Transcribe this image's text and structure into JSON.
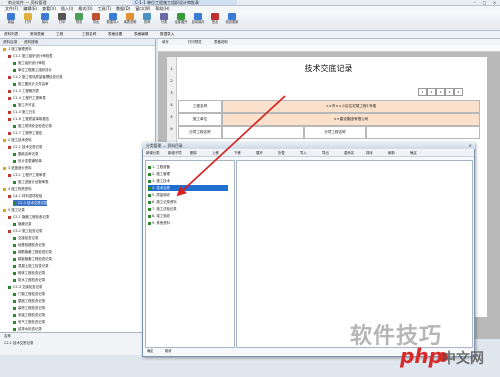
{
  "window": {
    "app_title": "筑业软件 — 资料管理",
    "document_title": "C-1-1 单位工程施工组织设计审批表",
    "controls": [
      "–",
      "□",
      "×"
    ]
  },
  "menubar": [
    "文件(F)",
    "编辑(E)",
    "查看(V)",
    "插入(I)",
    "格式(O)",
    "工具(T)",
    "数据(D)",
    "窗口(W)",
    "帮助(H)"
  ],
  "toolbar": [
    {
      "label": "新建",
      "color": "#3a7bd5"
    },
    {
      "label": "打开",
      "color": "#e0b040"
    },
    {
      "label": "保存",
      "color": "#3a7bd5"
    },
    {
      "label": "打印",
      "color": "#555555"
    },
    {
      "label": "预览",
      "color": "#4aa05a"
    },
    {
      "label": "导出",
      "color": "#c05030"
    },
    {
      "label": "数据导入",
      "color": "#3a7bd5"
    },
    {
      "label": "填表说明",
      "color": "#e09030"
    },
    {
      "label": "查询",
      "color": "#4a90c0"
    },
    {
      "label": "分类",
      "color": "#6a6aa0"
    },
    {
      "label": "全部展开",
      "color": "#3a9a3a"
    },
    {
      "label": "自动保存",
      "color": "#3a7bd5"
    },
    {
      "label": "签名",
      "color": "#c03030"
    },
    {
      "label": "检查更新",
      "color": "#3a7bd5"
    }
  ],
  "tabs": [
    "资料列表",
    "常用表格",
    "工程",
    "工程名称",
    "表格设置",
    "表格编辑",
    "数据录入"
  ],
  "left_panel": {
    "header": [
      "资料目录",
      "资料搜索"
    ],
    "tree": [
      {
        "text": "1 施工管理资料",
        "level": 0,
        "color": "o"
      },
      {
        "text": "C1-1 施工组织设计审批表",
        "level": 1,
        "color": "r"
      },
      {
        "text": "施工组织设计审批",
        "level": 2,
        "color": "g"
      },
      {
        "text": "单位工程施工组织设计",
        "level": 2,
        "color": "g"
      },
      {
        "text": "C1-2 施工现场质量管理检查记录",
        "level": 1,
        "color": "r"
      },
      {
        "text": "施工图设计文件会审",
        "level": 2,
        "color": "g"
      },
      {
        "text": "C1-3 工程概况表",
        "level": 1,
        "color": "r"
      },
      {
        "text": "C1-4 工程开工报审表",
        "level": 1,
        "color": "r"
      },
      {
        "text": "施工许可证",
        "level": 2,
        "color": "g"
      },
      {
        "text": "C1-5 施工日志",
        "level": 1,
        "color": "r"
      },
      {
        "text": "C1-6 工程质量事故报告",
        "level": 1,
        "color": "r"
      },
      {
        "text": "施工现场安全检查记录",
        "level": 2,
        "color": "g"
      },
      {
        "text": "C1-7 工程停工报告",
        "level": 1,
        "color": "r"
      },
      {
        "text": "2 施工技术资料",
        "level": 0,
        "color": "o"
      },
      {
        "text": "C2-1 技术交底记录",
        "level": 1,
        "color": "r"
      },
      {
        "text": "图纸会审记录",
        "level": 2,
        "color": "g"
      },
      {
        "text": "设计变更通知单",
        "level": 2,
        "color": "g"
      },
      {
        "text": "3 进度造价资料",
        "level": 0,
        "color": "o"
      },
      {
        "text": "C3-1 工程开工报审表",
        "level": 1,
        "color": "r"
      },
      {
        "text": "施工进度计划报审表",
        "level": 2,
        "color": "g"
      },
      {
        "text": "4 施工物资资料",
        "level": 0,
        "color": "o"
      },
      {
        "text": "C4-1 材料进场检验",
        "level": 1,
        "color": "r"
      },
      {
        "text": "C2-3 技术交底记录",
        "level": 2,
        "color": "g",
        "selected": true
      },
      {
        "text": "5 施工记录",
        "level": 0,
        "color": "o"
      },
      {
        "text": "C5-1 隐蔽工程验收记录",
        "level": 1,
        "color": "r"
      },
      {
        "text": "隐蔽记录",
        "level": 2,
        "color": "g"
      },
      {
        "text": "C5-2 施工检查记录",
        "level": 1,
        "color": "r"
      },
      {
        "text": "交接检查记录",
        "level": 2,
        "color": "g"
      },
      {
        "text": "地基验槽检查记录",
        "level": 2,
        "color": "g"
      },
      {
        "text": "钢筋隐蔽工程检查记录",
        "level": 2,
        "color": "g"
      },
      {
        "text": "模板隐蔽工程检查记录",
        "level": 2,
        "color": "g"
      },
      {
        "text": "混凝土施工检查记录",
        "level": 2,
        "color": "g"
      },
      {
        "text": "砌体工程检查记录",
        "level": 2,
        "color": "g"
      },
      {
        "text": "防水工程检查记录",
        "level": 2,
        "color": "g"
      },
      {
        "text": "C5-3 交接检查记录",
        "level": 1,
        "color": "g"
      },
      {
        "text": "门窗工程检查记录",
        "level": 2,
        "color": "g"
      },
      {
        "text": "屋面工程检查记录",
        "level": 2,
        "color": "g"
      },
      {
        "text": "装饰工程检查记录",
        "level": 2,
        "color": "g"
      },
      {
        "text": "安装工程检查记录",
        "level": 2,
        "color": "g"
      },
      {
        "text": "电气工程检查记录",
        "level": 2,
        "color": "g"
      },
      {
        "text": "给排水检查记录",
        "level": 2,
        "color": "g"
      }
    ],
    "bottom_rows": [
      "名称",
      "C2-1 技术交底记录"
    ]
  },
  "document": {
    "doc_tabs": [
      "填写",
      "打印预览",
      "表格说明"
    ],
    "title": "技术交底记录",
    "row_numbers": [
      "1",
      "2",
      "3",
      "4",
      "5",
      "6"
    ],
    "pager": [
      "1",
      "2",
      "3",
      "4",
      "5"
    ],
    "rows": [
      {
        "label": "工程名称",
        "value": "××市××小区住宅楼工程1号楼",
        "pink": true
      },
      {
        "label": "施工单位",
        "value": "××建设集团有限公司",
        "pink": true
      },
      {
        "label": "分项工程名称",
        "value": "",
        "extra": "分项工程名称"
      }
    ]
  },
  "dialog": {
    "title": "分类管理 — 资料目录",
    "menu": [
      "新增分类",
      "新增子项",
      "删除",
      "上移",
      "下移",
      "展开",
      "折叠",
      "导入",
      "导出",
      "重命名",
      "排序",
      "刷新",
      "确定"
    ],
    "tree": [
      {
        "text": "1. 工程准备",
        "selected": false
      },
      {
        "text": "2. 施工管理",
        "selected": false
      },
      {
        "text": "3. 施工技术",
        "selected": false
      },
      {
        "text": "4. 技术交底",
        "selected": true
      },
      {
        "text": "5. 质量验收",
        "selected": false
      },
      {
        "text": "6. 施工记录资料",
        "selected": false
      },
      {
        "text": "7. 施工试验记录",
        "selected": false
      },
      {
        "text": "8. 竣工验收",
        "selected": false
      },
      {
        "text": "9. 其他资料",
        "selected": false
      }
    ],
    "bottom": [
      "确定",
      "取消"
    ]
  },
  "watermark": {
    "zh": "软件技巧",
    "en": "php",
    "cn": "中文网"
  }
}
